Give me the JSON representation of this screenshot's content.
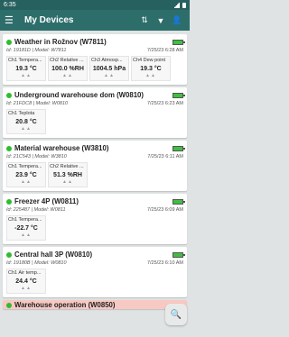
{
  "status": {
    "time": "6:35"
  },
  "appbar": {
    "title": "My Devices",
    "menu_icon": "☰",
    "sort_icon": "⇅",
    "filter_icon": "▼",
    "account_icon": "👤"
  },
  "devices": [
    {
      "name": "Weather in Rožnov (W7811)",
      "id": "Id: 19181D | Model: W7811",
      "time": "7/25/23 6:28 AM",
      "channels": [
        {
          "label": "Ch1 Tempera...",
          "value": "19.3 °C"
        },
        {
          "label": "Ch2 Relative ...",
          "value": "100.0 %RH"
        },
        {
          "label": "Ch3 Atmosp...",
          "value": "1004.5 hPa"
        },
        {
          "label": "Ch4 Dew point",
          "value": "19.3 °C"
        }
      ]
    },
    {
      "name": "Underground warehouse dom (W0810)",
      "id": "Id: 21FDC8 | Model: W0810",
      "time": "7/25/23 6:23 AM",
      "channels": [
        {
          "label": "Ch1 Teplota",
          "value": "20.8 °C"
        }
      ]
    },
    {
      "name": "Material warehouse (W3810)",
      "id": "Id: 21C543 | Model: W3810",
      "time": "7/25/23 6:11 AM",
      "channels": [
        {
          "label": "Ch1 Tempera...",
          "value": "23.9 °C"
        },
        {
          "label": "Ch2 Relative ...",
          "value": "51.3 %RH"
        }
      ]
    },
    {
      "name": "Freezer 4P (W0811)",
      "id": "Id: 225487 | Model: W0811",
      "time": "7/25/23 6:09 AM",
      "channels": [
        {
          "label": "Ch1 Tempera...",
          "value": "-22.7 °C"
        }
      ]
    },
    {
      "name": "Central hall 3P (W0810)",
      "id": "Id: 19180B | Model: W0810",
      "time": "7/25/23 6:10 AM",
      "channels": [
        {
          "label": "Ch1 Air temp...",
          "value": "24.4 °C"
        }
      ]
    }
  ],
  "last_device": {
    "name": "Warehouse operation (W0850)"
  },
  "fab": {
    "icon": "🔍"
  },
  "colors": {
    "appbar": "#2d6e6b",
    "online": "#2ebd2e",
    "alarm": "#f8c9c3"
  }
}
